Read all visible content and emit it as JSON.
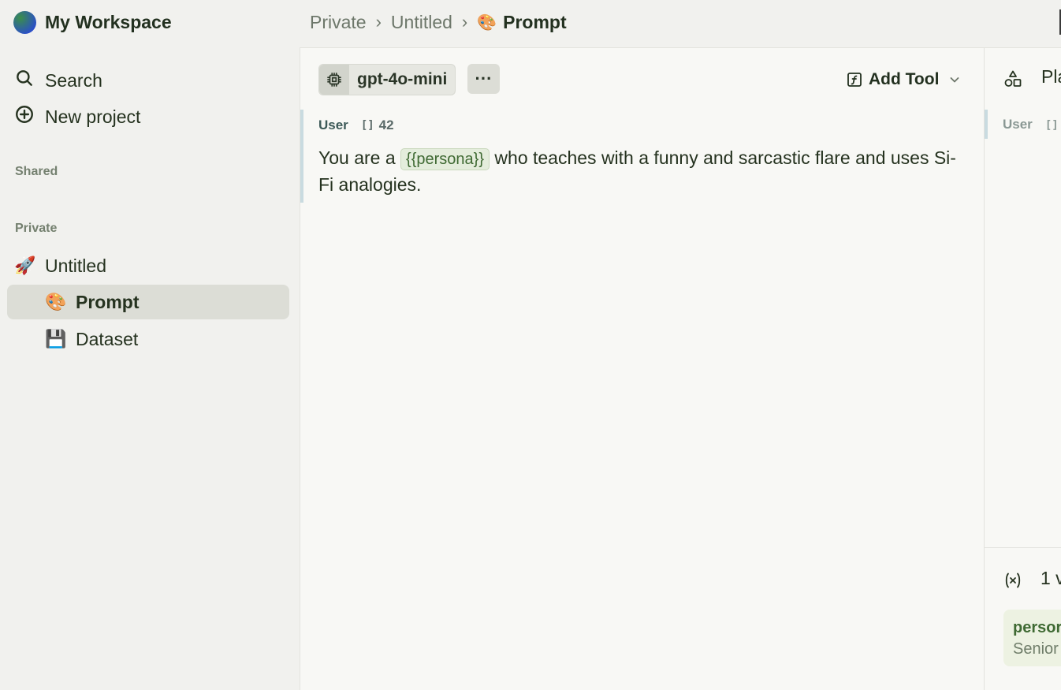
{
  "sidebar": {
    "workspace_name": "My Workspace",
    "nav": [
      {
        "label": "Search",
        "icon": "search-icon"
      },
      {
        "label": "New project",
        "icon": "plus-circle-icon"
      }
    ],
    "sections": {
      "shared": "Shared",
      "private": "Private"
    },
    "tree": [
      {
        "emoji": "🚀",
        "label": "Untitled",
        "level": 0
      },
      {
        "emoji": "🎨",
        "label": "Prompt",
        "level": 1,
        "active": true
      },
      {
        "emoji": "💾",
        "label": "Dataset",
        "level": 1
      }
    ]
  },
  "breadcrumb": {
    "items": [
      "Private",
      "Untitled"
    ],
    "current": {
      "emoji": "🎨",
      "label": "Prompt"
    }
  },
  "editor": {
    "model": "gpt-4o-mini",
    "more_label": "···",
    "add_tool_label": "Add Tool",
    "message": {
      "role": "User",
      "token_icon": "[]",
      "token_count": "42",
      "text_before": "You are a ",
      "variable": "{{persona}}",
      "text_after": " who teaches with a funny and sarcastic flare and uses Si-Fi analogies."
    }
  },
  "right_panel": {
    "title_partial": "Pla",
    "message_role": "User",
    "token_icon_partial": "[]",
    "variables_count_partial": "1 v",
    "variable_key_partial": "persor",
    "variable_value_partial": "Senior"
  },
  "colors": {
    "background": "#f1f1ee",
    "panel": "#f8f8f5",
    "active_item": "#dcddd6",
    "variable_bg": "#e4eddc",
    "variable_text": "#3f6a33",
    "message_accent": "#c9dbe0"
  }
}
